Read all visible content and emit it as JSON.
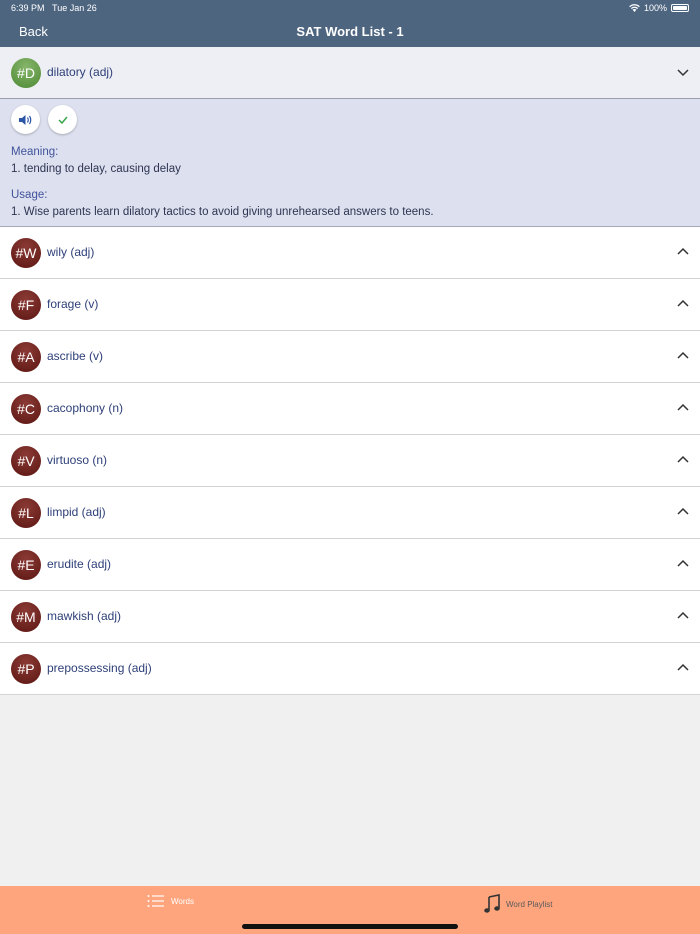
{
  "status": {
    "time": "6:39 PM",
    "date": "Tue Jan 26",
    "battery": "100%"
  },
  "nav": {
    "back_label": "Back",
    "title": "SAT Word List - 1"
  },
  "expanded": {
    "badge": "#D",
    "word": "dilatory (adj)",
    "meaning_label": "Meaning:",
    "meaning": "1. tending to delay, causing delay",
    "usage_label": "Usage:",
    "usage": "1. Wise parents learn dilatory tactics to avoid giving unrehearsed answers to teens."
  },
  "words": [
    {
      "badge": "#W",
      "word": "wily (adj)"
    },
    {
      "badge": "#F",
      "word": "forage (v)"
    },
    {
      "badge": "#A",
      "word": "ascribe (v)"
    },
    {
      "badge": "#C",
      "word": "cacophony (n)"
    },
    {
      "badge": "#V",
      "word": "virtuoso (n)"
    },
    {
      "badge": "#L",
      "word": "limpid (adj)"
    },
    {
      "badge": "#E",
      "word": "erudite (adj)"
    },
    {
      "badge": "#M",
      "word": "mawkish (adj)"
    },
    {
      "badge": "#P",
      "word": "prepossessing (adj)"
    }
  ],
  "tabs": {
    "words_label": "Words",
    "playlist_label": "Word Playlist"
  },
  "colors": {
    "nav": "#4e6580",
    "tabbar": "#ffa57e",
    "badge": "#6e211c",
    "badge_active": "#62a04a"
  }
}
